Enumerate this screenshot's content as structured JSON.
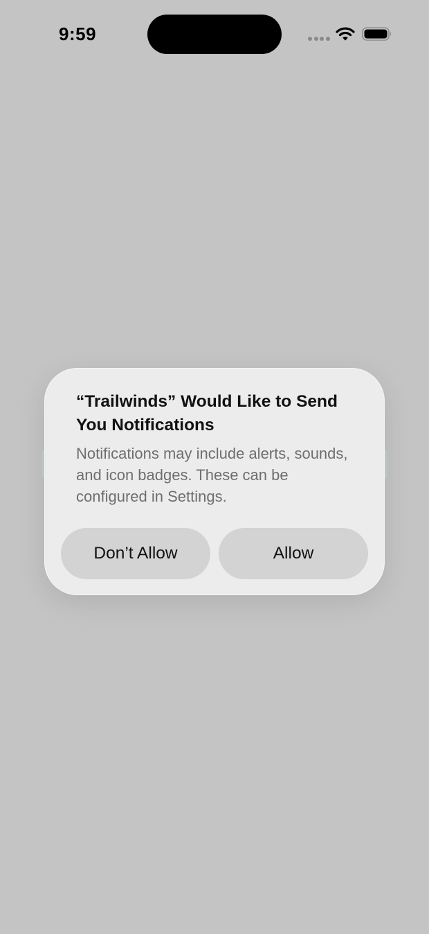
{
  "status_bar": {
    "time": "9:59",
    "icons": [
      "signal-icon",
      "wifi-icon",
      "battery-icon"
    ]
  },
  "alert": {
    "title": "“Trailwinds” Would Like to Send You Notifications",
    "message": "Notifications may include alerts, sounds, and icon badges. These can be configured in Settings.",
    "buttons": {
      "deny_label": "Don’t Allow",
      "allow_label": "Allow"
    }
  },
  "colors": {
    "backdrop": "#c4c4c4",
    "alert_background": "#ececec",
    "button_background": "#d3d3d3",
    "message_text": "#6e6e6e"
  }
}
